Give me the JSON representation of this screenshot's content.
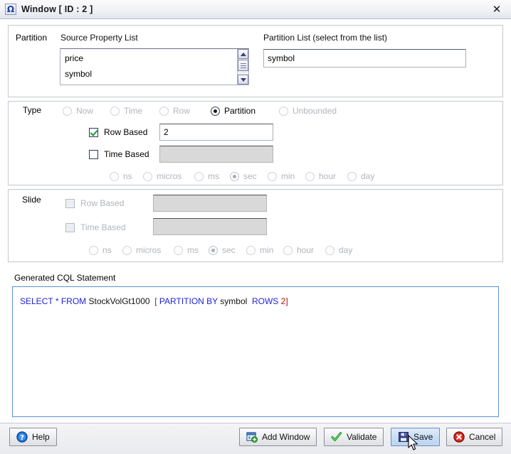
{
  "window": {
    "title": "Window [ ID : 2 ]",
    "icon": "omega-icon",
    "close_label": "✕"
  },
  "partition": {
    "label": "Partition",
    "source_list_label": "Source Property List",
    "source_items": [
      "price",
      "symbol"
    ],
    "partition_list_label": "Partition List (select from the list)",
    "partition_list_value": "symbol"
  },
  "type": {
    "label": "Type",
    "options": [
      {
        "label": "Now",
        "selected": false,
        "disabled": true
      },
      {
        "label": "Time",
        "selected": false,
        "disabled": true
      },
      {
        "label": "Row",
        "selected": false,
        "disabled": true
      },
      {
        "label": "Partition",
        "selected": true,
        "disabled": false
      },
      {
        "label": "Unbounded",
        "selected": false,
        "disabled": true
      }
    ],
    "row_based": {
      "label": "Row Based",
      "checked": true,
      "disabled": false,
      "value": "2"
    },
    "time_based": {
      "label": "Time Based",
      "checked": false,
      "disabled": false,
      "value": ""
    },
    "units": [
      {
        "label": "ns",
        "selected": false
      },
      {
        "label": "micros",
        "selected": false
      },
      {
        "label": "ms",
        "selected": false
      },
      {
        "label": "sec",
        "selected": true
      },
      {
        "label": "min",
        "selected": false
      },
      {
        "label": "hour",
        "selected": false
      },
      {
        "label": "day",
        "selected": false
      }
    ]
  },
  "slide": {
    "label": "Slide",
    "row_based": {
      "label": "Row Based",
      "checked": false,
      "disabled": true,
      "value": ""
    },
    "time_based": {
      "label": "Time Based",
      "checked": false,
      "disabled": true,
      "value": ""
    },
    "units": [
      {
        "label": "ns",
        "selected": false
      },
      {
        "label": "micros",
        "selected": false
      },
      {
        "label": "ms",
        "selected": false
      },
      {
        "label": "sec",
        "selected": true
      },
      {
        "label": "min",
        "selected": false
      },
      {
        "label": "hour",
        "selected": false
      },
      {
        "label": "day",
        "selected": false
      }
    ]
  },
  "cql": {
    "label": "Generated CQL Statement",
    "tokens": [
      {
        "text": "SELECT",
        "kind": "kw"
      },
      {
        "text": " ",
        "kind": "ident"
      },
      {
        "text": "*",
        "kind": "kw"
      },
      {
        "text": " ",
        "kind": "ident"
      },
      {
        "text": "FROM",
        "kind": "kw"
      },
      {
        "text": " ",
        "kind": "ident"
      },
      {
        "text": "StockVolGt1000",
        "kind": "ident"
      },
      {
        "text": "  ",
        "kind": "ident"
      },
      {
        "text": "[",
        "kind": "brk"
      },
      {
        "text": " ",
        "kind": "ident"
      },
      {
        "text": "PARTITION BY",
        "kind": "kw"
      },
      {
        "text": " ",
        "kind": "ident"
      },
      {
        "text": "symbol",
        "kind": "ident"
      },
      {
        "text": "  ",
        "kind": "ident"
      },
      {
        "text": "ROWS",
        "kind": "kw"
      },
      {
        "text": " ",
        "kind": "ident"
      },
      {
        "text": "2",
        "kind": "num"
      },
      {
        "text": "]",
        "kind": "brk"
      }
    ],
    "plain": "SELECT * FROM StockVolGt1000  [ PARTITION BY symbol  ROWS 2]"
  },
  "buttons": {
    "help": {
      "label": "Help",
      "icon": "question-circle-icon"
    },
    "add_window": {
      "label": "Add Window",
      "icon": "add-window-icon"
    },
    "validate": {
      "label": "Validate",
      "icon": "green-check-icon"
    },
    "save": {
      "label": "Save",
      "icon": "floppy-disk-icon",
      "hovered": true
    },
    "cancel": {
      "label": "Cancel",
      "icon": "red-x-circle-icon"
    }
  },
  "colors": {
    "keyword": "#1f22d8",
    "bracket": "#b01010",
    "accent_border": "#5b8ed6",
    "checkmark_green": "#1a9637"
  }
}
